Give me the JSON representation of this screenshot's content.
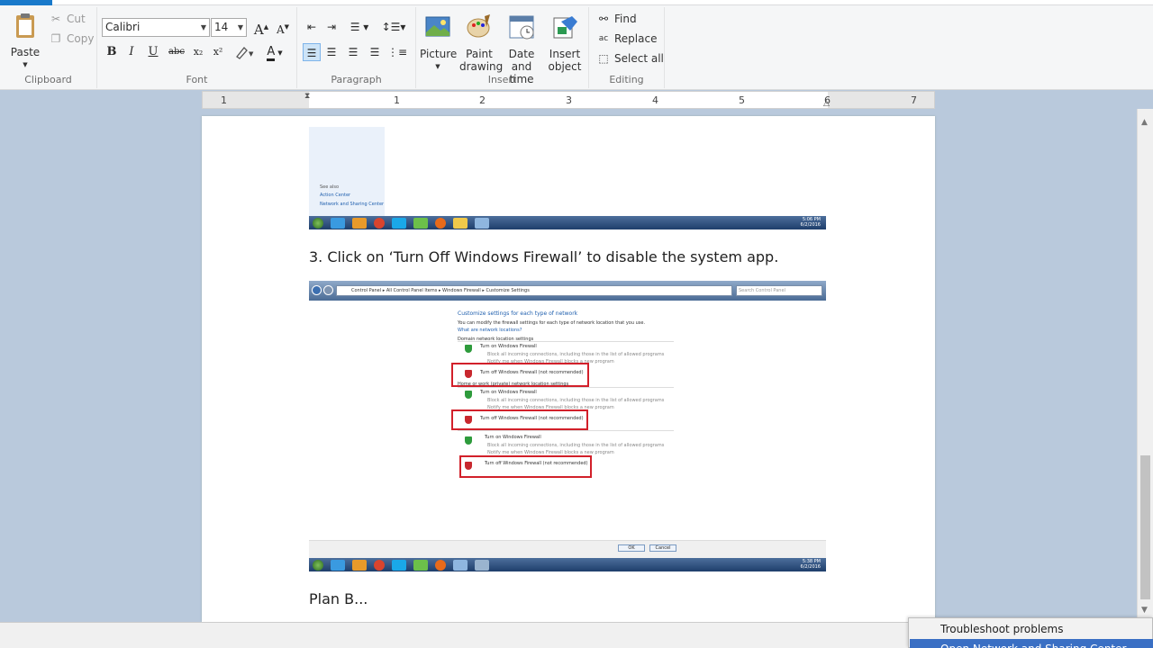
{
  "ribbon": {
    "clipboard": {
      "label": "Clipboard",
      "paste": "Paste",
      "cut": "Cut",
      "copy": "Copy"
    },
    "font": {
      "label": "Font",
      "family": "Calibri",
      "size": "14",
      "grow": "A",
      "shrink": "A",
      "bold": "B",
      "italic": "I",
      "underline": "U",
      "strike": "abc",
      "subscript": "x₂",
      "superscript": "x²",
      "color": "A"
    },
    "paragraph": {
      "label": "Paragraph"
    },
    "insert": {
      "label": "Insert",
      "picture": "Picture",
      "paint_drawing": "Paint drawing",
      "date_time": "Date and time",
      "insert_object": "Insert object"
    },
    "editing": {
      "label": "Editing",
      "find": "Find",
      "replace": "Replace",
      "select_all": "Select all"
    }
  },
  "ruler": {
    "ticks": [
      "1",
      "1",
      "2",
      "3",
      "4",
      "5",
      "6",
      "7"
    ]
  },
  "document": {
    "shot1": {
      "see_also": "See also",
      "action_center": "Action Center",
      "network_center": "Network and Sharing Center",
      "time": "5:06 PM",
      "date": "6/2/2016"
    },
    "step3": "3.  Click on ‘Turn Off Windows Firewall’ to disable the system app.",
    "shot2": {
      "address": "Control Panel ▸ All Control Panel Items ▸ Windows Firewall ▸ Customize Settings",
      "search": "Search Control Panel",
      "heading": "Customize settings for each type of network",
      "intro": "You can modify the firewall settings for each type of network location that you use.",
      "link": "What are network locations?",
      "domain": "Domain network location settings",
      "home": "Home or work (private) network location settings",
      "on": "Turn on Windows Firewall",
      "block": "Block all incoming connections, including those in the list of allowed programs",
      "notify": "Notify me when Windows Firewall blocks a new program",
      "off": "Turn off Windows Firewall (not recommended)",
      "ok": "OK",
      "cancel": "Cancel",
      "time": "5:38 PM",
      "date": "6/2/2016"
    },
    "planb": "Plan B..."
  },
  "context_menu": {
    "items": [
      "Troubleshoot problems",
      "Open Network and Sharing Center"
    ]
  },
  "colors": {
    "accent": "#1979ca",
    "highlight": "#3a6fc4",
    "red_box": "#d2202a"
  }
}
